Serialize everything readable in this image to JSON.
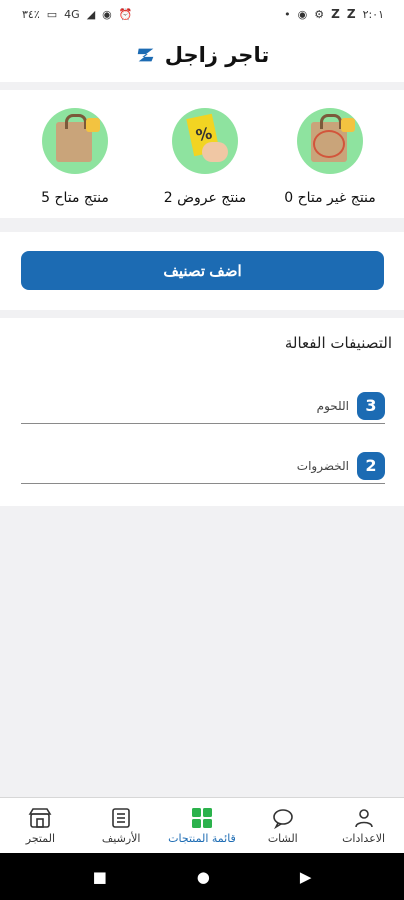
{
  "status_bar": {
    "time": "٢:٠١",
    "battery": "٣٤٪",
    "network": "4G"
  },
  "header": {
    "title": "تاجر زاجل"
  },
  "stats": [
    {
      "label": "0 منتج غير متاح"
    },
    {
      "label": "2 منتج عروض"
    },
    {
      "label": "5 منتج متاح"
    }
  ],
  "actions": {
    "add_category": "اضف تصنيف"
  },
  "categories": {
    "title": "التصنيفات الفعالة",
    "items": [
      {
        "name": "اللحوم",
        "count": "3"
      },
      {
        "name": "الخضروات",
        "count": "2"
      }
    ]
  },
  "bottom_nav": [
    {
      "label": "الاعدادات",
      "icon": "person-icon"
    },
    {
      "label": "الشات",
      "icon": "chat-icon"
    },
    {
      "label": "قائمة المنتجات",
      "icon": "grid-icon",
      "active": true
    },
    {
      "label": "الأرشيف",
      "icon": "list-icon"
    },
    {
      "label": "المتجر",
      "icon": "store-icon"
    }
  ],
  "colors": {
    "primary": "#1c6bb3",
    "accent_green": "#2bb24c",
    "icon_circle": "#8ee39f"
  }
}
